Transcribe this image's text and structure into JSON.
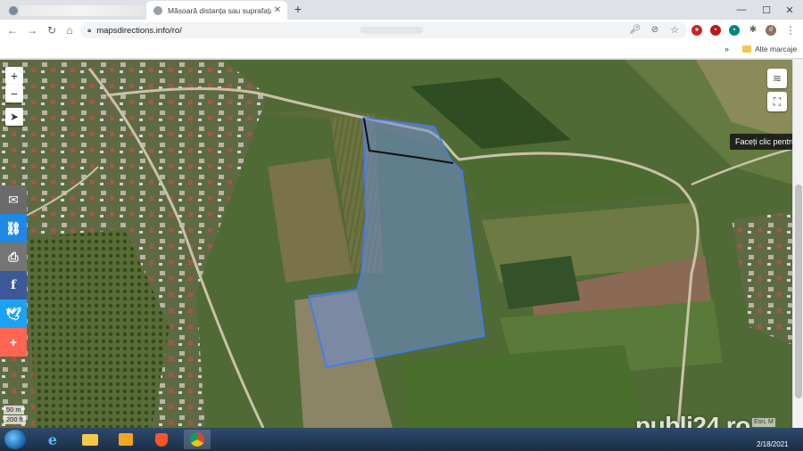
{
  "browser": {
    "tabs": [
      {
        "title": "",
        "active": false
      },
      {
        "title": "Măsoară distanța sau suprafața p",
        "active": true
      }
    ],
    "new_tab_label": "+",
    "window_controls": {
      "minimize": "—",
      "maximize": "☐",
      "close": "✕"
    },
    "url": "mapsdirections.info/ro/",
    "bookmarks_folder": "Alte marcaje",
    "bookmarks_chevron": "»"
  },
  "map": {
    "zoom_in": "+",
    "zoom_out": "−",
    "locate_icon": "navigation-arrow-icon",
    "tooltip": "Faceți clic pentru a",
    "scale_metric": "50 m",
    "scale_imperial": "200 ft",
    "attribution": "Esri, M",
    "colors": {
      "polygon_fill": "#6f8ed6",
      "polygon_stroke": "#3b7bff",
      "road": "#c9c2a8"
    }
  },
  "share_bar": [
    {
      "icon": "email-icon",
      "color": "#6b6b6b"
    },
    {
      "icon": "link-icon",
      "color": "#1e88e5"
    },
    {
      "icon": "print-icon",
      "color": "#757575"
    },
    {
      "icon": "facebook-icon",
      "color": "#3b5998"
    },
    {
      "icon": "twitter-icon",
      "color": "#1da1f2"
    },
    {
      "icon": "more-plus-icon",
      "color": "#ff6550"
    }
  ],
  "taskbar": {
    "date": "2/18/2021",
    "apps": [
      "internet-explorer-icon",
      "file-explorer-icon",
      "media-player-icon",
      "brave-icon",
      "chrome-icon"
    ]
  },
  "watermark": "publi24.ro"
}
